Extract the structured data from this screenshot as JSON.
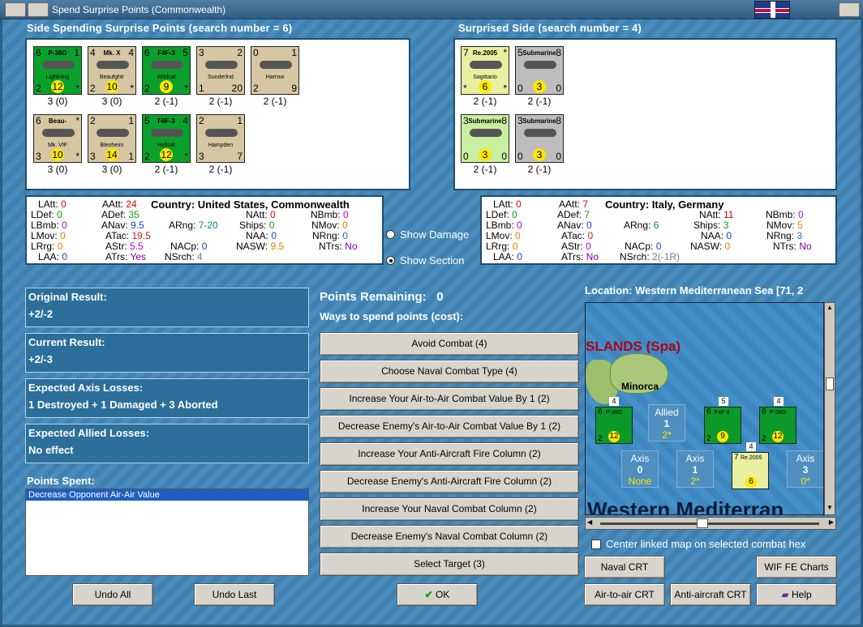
{
  "window": {
    "title": "Spend Surprise Points (Commonwealth)"
  },
  "left_side": {
    "header": "Side Spending Surprise Points (search number = 6)",
    "units": [
      {
        "name": "P-38G",
        "sub": "Lightning",
        "nw": "6",
        "ne": "1",
        "sw": "2",
        "se": "*",
        "cost": "12",
        "color": "#0aa02c",
        "cap": "3 (0)"
      },
      {
        "name": "Mk. X",
        "sub": "Beaufghtr",
        "nw": "4",
        "ne": "4",
        "sw": "2",
        "se": "*",
        "cost": "10",
        "color": "#d7c6a2",
        "cap": "3 (0)"
      },
      {
        "name": "F4F-3",
        "sub": "Wildcat",
        "nw": "6",
        "ne": "5",
        "sw": "2",
        "se": "*",
        "cost": "9",
        "color": "#0aa02c",
        "cap": "2 (-1)"
      },
      {
        "name": "",
        "sub": "Sunderlnd",
        "nw": "3",
        "ne": "2",
        "sw": "1",
        "se": "20",
        "cost": "",
        "color": "#d7c6a2",
        "cap": "2 (-1)"
      },
      {
        "name": "",
        "sub": "Harrow",
        "nw": "0",
        "ne": "1",
        "sw": "2",
        "se": "9",
        "cost": "",
        "color": "#d7c6a2",
        "cap": "2 (-1)"
      },
      {
        "name": "Beau-",
        "sub": "Mk. VIF",
        "nw": "6",
        "ne": "*",
        "sw": "3",
        "se": "*",
        "cost": "10",
        "color": "#d7c6a2",
        "cap": "3 (0)"
      },
      {
        "name": "",
        "sub": "Blenheim",
        "nw": "2",
        "ne": "1",
        "sw": "3",
        "se": "1",
        "cost": "14",
        "color": "#d7c6a2",
        "cap": "3 (0)"
      },
      {
        "name": "F6F-3",
        "sub": "Hellcat",
        "nw": "5",
        "ne": "4",
        "sw": "2",
        "se": "*",
        "cost": "12",
        "color": "#0aa02c",
        "cap": "2 (-1)"
      },
      {
        "name": "",
        "sub": "Hampden",
        "nw": "2",
        "ne": "1",
        "sw": "3",
        "se": "7",
        "cost": "",
        "color": "#d7c6a2",
        "cap": "2 (-1)"
      }
    ]
  },
  "right_side": {
    "header": "Surprised Side (search number = 4)",
    "units": [
      {
        "name": "Re.2005",
        "sub": "Sagittario",
        "nw": "7",
        "ne": "*",
        "sw": "*",
        "se": "*",
        "cost": "6",
        "color": "#e8f0a0",
        "cap": "2 (-1)"
      },
      {
        "name": "Submarine",
        "sub": "",
        "nw": "5",
        "ne": "8",
        "sw": "0",
        "se": "0",
        "cost": "3",
        "color": "#bdbdbd",
        "cap": "2 (-1)"
      },
      {
        "name": "Submarine",
        "sub": "",
        "nw": "3",
        "ne": "8",
        "sw": "0",
        "se": "0",
        "cost": "3",
        "color": "#c8f0a0",
        "cap": "2 (-1)"
      },
      {
        "name": "Submarine",
        "sub": "",
        "nw": "3",
        "ne": "8",
        "sw": "0",
        "se": "0",
        "cost": "3",
        "color": "#bdbdbd",
        "cap": "2 (-1)"
      }
    ]
  },
  "left_stats": {
    "latt_l": "LAtt:",
    "latt": "0",
    "aatt_l": "AAtt:",
    "aatt": "24",
    "country_l": "Country:",
    "country": "United States, Commonwealth",
    "ldef_l": "LDef:",
    "ldef": "0",
    "adef_l": "ADef:",
    "adef": "35",
    "natt_l": "NAtt:",
    "natt": "0",
    "nbmb_l": "NBmb:",
    "nbmb": "0",
    "lbmb_l": "LBmb:",
    "lbmb": "0",
    "anav_l": "ANav:",
    "anav": "9.5",
    "arng_l": "ARng:",
    "arng": "7-20",
    "ships_l": "Ships:",
    "ships": "0",
    "nmov_l": "NMov:",
    "nmov": "0",
    "lmov_l": "LMov:",
    "lmov": "0",
    "atac_l": "ATac:",
    "atac": "19.5",
    "naa_l": "NAA:",
    "naa": "0",
    "nrng_l": "NRng:",
    "nrng": "0",
    "lrng_l": "LRrg:",
    "lrng": "0",
    "astr_l": "AStr:",
    "astr": "5.5",
    "nacp_l": "NACp:",
    "nacp": "0",
    "nasw_l": "NASW:",
    "nasw": "9.5",
    "ntrs_l": "NTrs:",
    "ntrs": "No",
    "laa_l": "LAA:",
    "laa": "0",
    "atrs_l": "ATrs:",
    "atrs": "Yes",
    "nsrch_l": "NSrch:",
    "nsrch": "4"
  },
  "right_stats": {
    "latt_l": "LAtt:",
    "latt": "0",
    "aatt_l": "AAtt:",
    "aatt": "7",
    "country_l": "Country:",
    "country": "Italy, Germany",
    "ldef_l": "LDef:",
    "ldef": "0",
    "adef_l": "ADef:",
    "adef": "7",
    "natt_l": "NAtt:",
    "natt": "11",
    "nbmb_l": "NBmb:",
    "nbmb": "0",
    "lbmb_l": "LBmb:",
    "lbmb": "0",
    "anav_l": "ANav:",
    "anav": "0",
    "arng_l": "ARng:",
    "arng": "6",
    "ships_l": "Ships:",
    "ships": "3",
    "nmov_l": "NMov:",
    "nmov": "5",
    "lmov_l": "LMov:",
    "lmov": "0",
    "atac_l": "ATac:",
    "atac": "0",
    "naa_l": "NAA:",
    "naa": "0",
    "nrng_l": "NRng:",
    "nrng": "3",
    "lrng_l": "LRrg:",
    "lrng": "0",
    "astr_l": "AStr:",
    "astr": "0",
    "nacp_l": "NACp:",
    "nacp": "0",
    "nasw_l": "NASW:",
    "nasw": "0",
    "ntrs_l": "NTrs:",
    "ntrs": "No",
    "laa_l": "LAA:",
    "laa": "0",
    "atrs_l": "ATrs:",
    "atrs": "No",
    "nsrch_l": "NSrch:",
    "nsrch": "2(-1R)"
  },
  "radios": {
    "show_damage": "Show Damage",
    "show_section": "Show Section"
  },
  "results": {
    "original_l": "Original Result:",
    "original": "+2/-2",
    "current_l": "Current Result:",
    "current": "+2/-3",
    "axis_l": "Expected Axis Losses:",
    "axis": "1 Destroyed + 1 Damaged + 3 Aborted",
    "allied_l": "Expected Allied Losses:",
    "allied": "No effect",
    "spent_l": "Points Spent:",
    "spent_item": "Decrease Opponent Air-Air Value"
  },
  "points": {
    "remaining_l": "Points Remaining:",
    "remaining": "0",
    "ways": "Ways to spend points (cost):"
  },
  "ways": [
    "Avoid Combat (4)",
    "Choose Naval Combat Type (4)",
    "Increase Your Air-to-Air Combat Value By 1 (2)",
    "Decrease Enemy's Air-to-Air Combat Value By 1 (2)",
    "Increase Your Anti-Aircraft Fire Column (2)",
    "Decrease Enemy's Anti-Aircraft Fire Column (2)",
    "Increase Your Naval Combat Column (2)",
    "Decrease Enemy's Naval Combat Column (2)",
    "Select Target (3)"
  ],
  "location": "Location: Western Mediterranean Sea [71, 2",
  "map": {
    "islands": "SLANDS (Spa)",
    "minorca": "Minorca",
    "sea": "Western Mediterran",
    "c1": "P-38G",
    "c2": "F4F-3",
    "c3": "P-38G",
    "c4": "Re.2005",
    "allied_l": "Allied",
    "allied_n": "1",
    "allied_s": "2*",
    "axis0_l": "Axis",
    "axis0_n": "0",
    "axis0_s": "None",
    "axis1_l": "Axis",
    "axis1_n": "1",
    "axis1_s": "2*",
    "axis3_l": "Axis",
    "axis3_n": "3",
    "axis3_s": "0*"
  },
  "center_map": "Center linked map on selected combat hex",
  "buttons": {
    "undo_all": "Undo All",
    "undo_last": "Undo Last",
    "ok": "OK",
    "naval_crt": "Naval CRT",
    "wif_charts": "WIF FE Charts",
    "air_crt": "Air-to-air CRT",
    "aa_crt": "Anti-aircraft CRT",
    "help": "Help"
  }
}
